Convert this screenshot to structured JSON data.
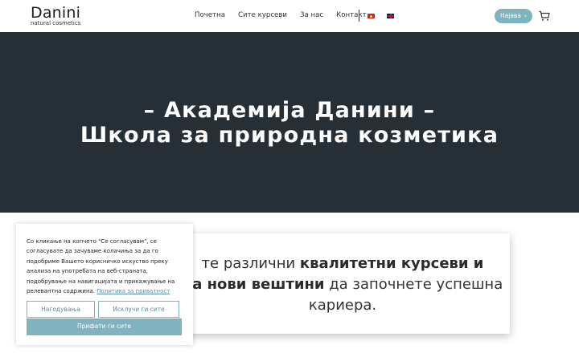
{
  "brand": {
    "logo_name": "Danini",
    "logo_tagline": "natural cosmetics"
  },
  "nav": {
    "items": [
      {
        "label": "Почетна"
      },
      {
        "label": "Сите курсеви"
      },
      {
        "label": "За нас"
      },
      {
        "label": "Контакт"
      }
    ],
    "languages": [
      "mk-flag-icon",
      "gb-flag-icon"
    ]
  },
  "header": {
    "login_label": "Најава",
    "login_chevron": "›",
    "cart_icon": "cart-icon",
    "accent_color": "#7fb3c0"
  },
  "hero": {
    "title_line1": "– Академија Данини –",
    "title_line2": "Школа за природна козметика",
    "background_color": "#262f35"
  },
  "intro": {
    "seg1": "те различни ",
    "seg2": "квалитетни курсеви и",
    "seg3": "на нови вештини",
    "seg4": " да започнете успешна",
    "seg5": "кариера."
  },
  "cookie_banner": {
    "text": "Со кликање на копчето \"Се согласувам\", се согласувате да зачуваме колачиња за да го подобриме Вашето корисничко искуство преку анализа на употребата на веб-страната, подобрување на навигацијата и прикажување на релевантна содржина.",
    "policy_link": "Политика за приватност",
    "settings_button": "Нагодувања",
    "reject_button": "Исклучи ги сите",
    "accept_button": "Прифати ги сите"
  }
}
